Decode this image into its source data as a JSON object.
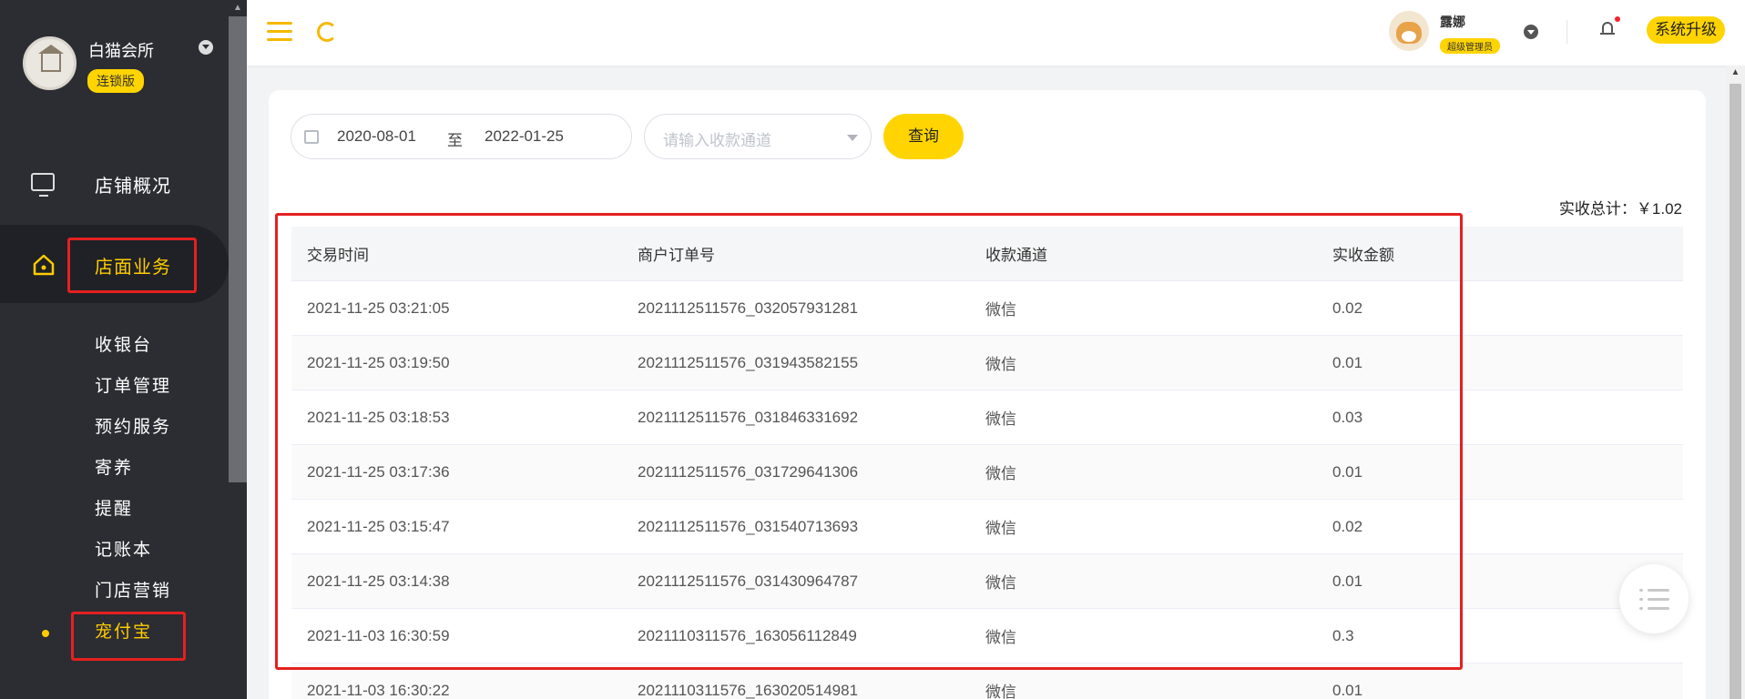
{
  "sidebar": {
    "store_name": "白猫会所",
    "store_badge": "连锁版",
    "nav": [
      {
        "label": "店铺概况",
        "icon": "monitor-icon"
      },
      {
        "label": "店面业务",
        "icon": "home-icon",
        "active": true
      }
    ],
    "sub_items": [
      "收银台",
      "订单管理",
      "预约服务",
      "寄养",
      "提醒",
      "记账本",
      "门店营销",
      "宠付宝"
    ],
    "active_sub": "宠付宝"
  },
  "header": {
    "user_name": "露娜",
    "user_role": "超级管理员",
    "upgrade_label": "系统升级"
  },
  "filters": {
    "date_start": "2020-08-01",
    "date_sep": "至",
    "date_end": "2022-01-25",
    "channel_placeholder": "请输入收款通道",
    "query_label": "查询"
  },
  "summary": {
    "total_label": "实收总计：￥1.02"
  },
  "table": {
    "columns": [
      "交易时间",
      "商户订单号",
      "收款通道",
      "实收金额"
    ],
    "rows": [
      [
        "2021-11-25 03:21:05",
        "2021112511576_032057931281",
        "微信",
        "0.02"
      ],
      [
        "2021-11-25 03:19:50",
        "2021112511576_031943582155",
        "微信",
        "0.01"
      ],
      [
        "2021-11-25 03:18:53",
        "2021112511576_031846331692",
        "微信",
        "0.03"
      ],
      [
        "2021-11-25 03:17:36",
        "2021112511576_031729641306",
        "微信",
        "0.01"
      ],
      [
        "2021-11-25 03:15:47",
        "2021112511576_031540713693",
        "微信",
        "0.02"
      ],
      [
        "2021-11-25 03:14:38",
        "2021112511576_031430964787",
        "微信",
        "0.01"
      ],
      [
        "2021-11-03 16:30:59",
        "2021110311576_163056112849",
        "微信",
        "0.3"
      ],
      [
        "2021-11-03 16:30:22",
        "2021110311576_163020514981",
        "微信",
        "0.01"
      ]
    ]
  },
  "colors": {
    "accent": "#ffd400",
    "sidebar_bg": "#2b2d33",
    "highlight_box": "#e52020"
  }
}
